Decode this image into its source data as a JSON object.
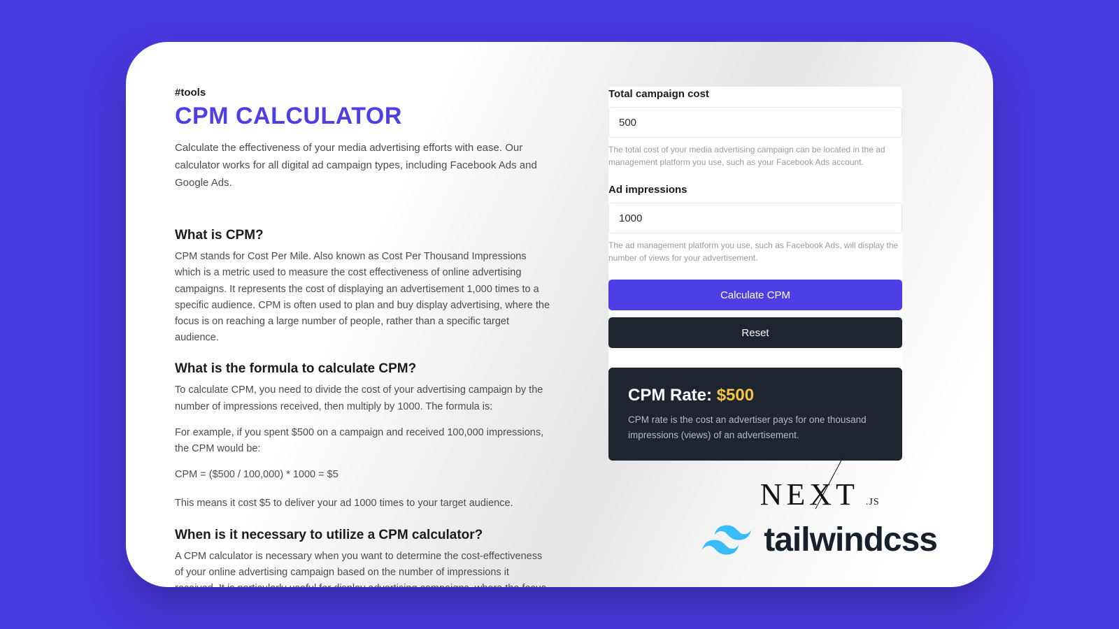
{
  "tag": "#tools",
  "title": "CPM CALCULATOR",
  "intro": "Calculate the effectiveness of your media advertising efforts with ease. Our calculator works for all digital ad campaign types, including Facebook Ads and Google Ads.",
  "sections": {
    "what_is": {
      "heading": "What is CPM?",
      "body": "CPM stands for Cost Per Mile. Also known as Cost Per Thousand Impressions which is a metric used to measure the cost effectiveness of online advertising campaigns. It represents the cost of displaying an advertisement 1,000 times to a specific audience. CPM is often used to plan and buy display advertising, where the focus is on reaching a large number of people, rather than a specific target audience."
    },
    "formula": {
      "heading": "What is the formula to calculate CPM?",
      "p1": "To calculate CPM, you need to divide the cost of your advertising campaign by the number of impressions received, then multiply by 1000. The formula is:",
      "p2": "For example, if you spent $500 on a campaign and received 100,000 impressions, the CPM would be:",
      "expr": "CPM = ($500 / 100,000) * 1000 = $5",
      "p3": "This means it cost $5 to deliver your ad 1000 times to your target audience."
    },
    "when": {
      "heading": "When is it necessary to utilize a CPM calculator?",
      "body": "A CPM calculator is necessary when you want to determine the cost-effectiveness of your online advertising campaign based on the number of impressions it received. It is particularly useful for display advertising campaigns, where the focus is on reaching a large audience, rather than a specific target audience."
    }
  },
  "form": {
    "cost": {
      "label": "Total campaign cost",
      "value": "500",
      "help": "The total cost of your media advertising campaign can be located in the ad management platform you use, such as your Facebook Ads account."
    },
    "impressions": {
      "label": "Ad impressions",
      "value": "1000",
      "help": "The ad management platform you use, such as Facebook Ads, will display the number of views for your advertisement."
    },
    "calculate_label": "Calculate CPM",
    "reset_label": "Reset"
  },
  "result": {
    "label": "CPM Rate: ",
    "amount": "$500",
    "desc": "CPM rate is the cost an advertiser pays for one thousand impressions (views) of an advertisement."
  },
  "logos": {
    "next": "NEXT",
    "next_suffix": ".JS",
    "tailwind": "tailwindcss"
  }
}
